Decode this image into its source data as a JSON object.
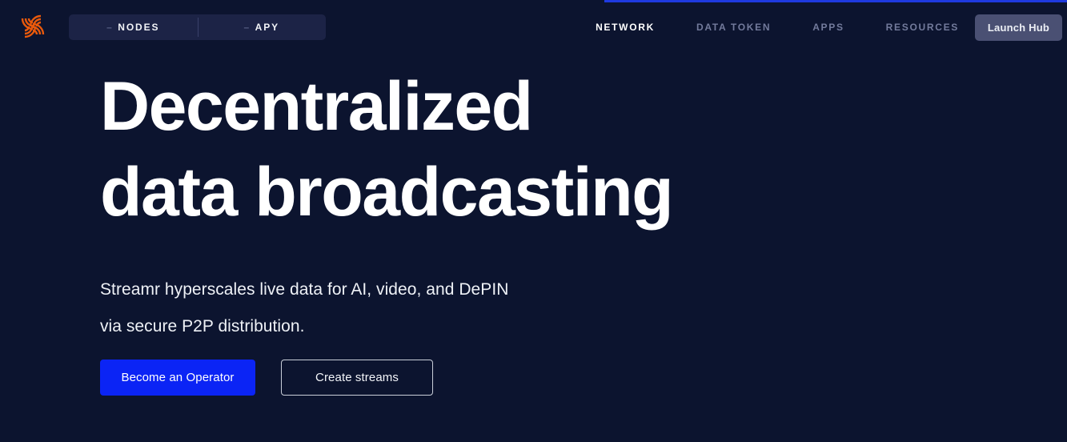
{
  "page": {
    "background_color": "#0c142f",
    "accent_blue": "#0b24f5",
    "logo_orange": "#e8590c"
  },
  "loading_bar": {
    "name": "page-loading-bar",
    "color": "#1f3ae0",
    "progress_percent": 43
  },
  "header": {
    "logo_alt": "Streamr",
    "stats": [
      {
        "value": "–",
        "label": "NODES"
      },
      {
        "value": "–",
        "label": "APY"
      }
    ],
    "nav": [
      {
        "label": "NETWORK",
        "active": true
      },
      {
        "label": "DATA TOKEN",
        "active": false
      },
      {
        "label": "APPS",
        "active": false
      },
      {
        "label": "RESOURCES",
        "active": false
      }
    ],
    "launch_hub_label": "Launch Hub"
  },
  "hero": {
    "title": "Decentralized\ndata broadcasting",
    "subtitle": "Streamr hyperscales live data for AI, video, and DePIN\nvia secure P2P distribution.",
    "primary_cta": "Become an Operator",
    "secondary_cta": "Create streams"
  }
}
